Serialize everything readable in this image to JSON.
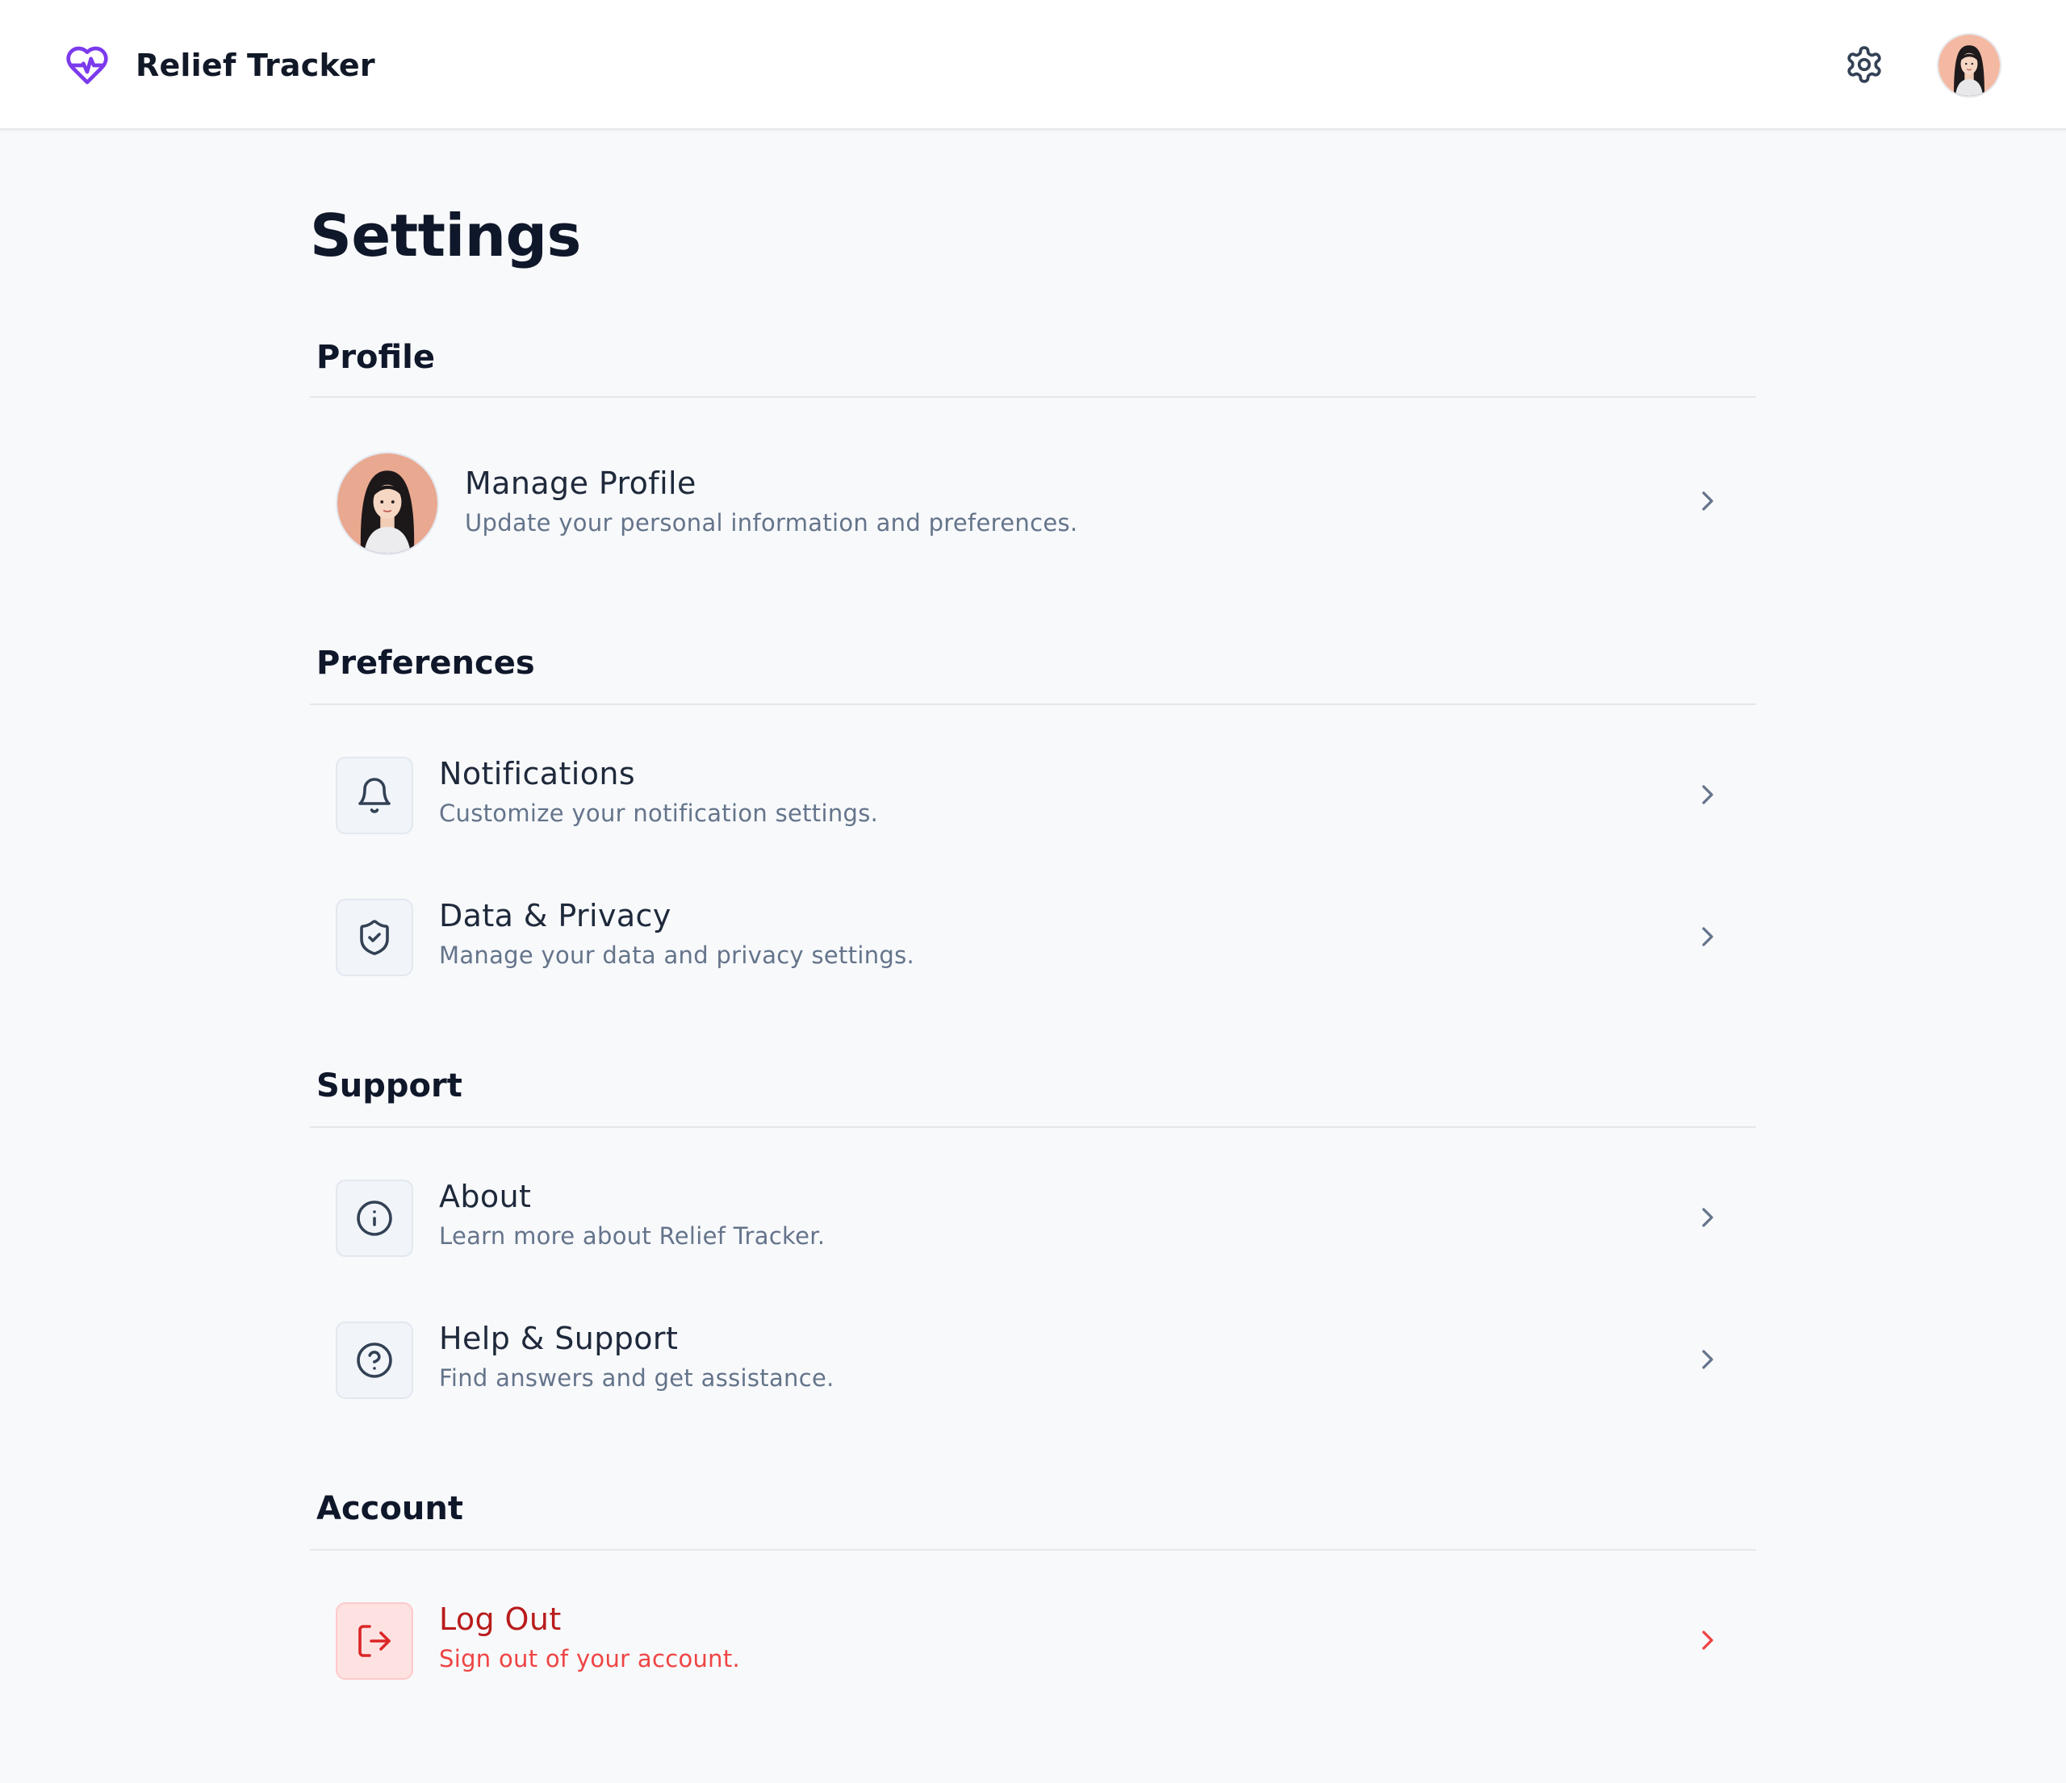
{
  "app": {
    "title": "Relief Tracker",
    "accent_color": "#7c3aed",
    "logo_icon": "heart-pulse-icon"
  },
  "header": {
    "settings_icon": "gear-icon",
    "avatar_icon": "user-avatar"
  },
  "page": {
    "title": "Settings"
  },
  "sections": {
    "profile": {
      "heading": "Profile",
      "items": [
        {
          "title": "Manage Profile",
          "subtitle": "Update your personal information and preferences.",
          "icon": "user-avatar"
        }
      ]
    },
    "preferences": {
      "heading": "Preferences",
      "items": [
        {
          "title": "Notifications",
          "subtitle": "Customize your notification settings.",
          "icon": "bell-icon"
        },
        {
          "title": "Data & Privacy",
          "subtitle": "Manage your data and privacy settings.",
          "icon": "shield-check-icon"
        }
      ]
    },
    "support": {
      "heading": "Support",
      "items": [
        {
          "title": "About",
          "subtitle": "Learn more about Relief Tracker.",
          "icon": "info-icon"
        },
        {
          "title": "Help & Support",
          "subtitle": "Find answers and get assistance.",
          "icon": "help-circle-icon"
        }
      ]
    },
    "account": {
      "heading": "Account",
      "items": [
        {
          "title": "Log Out",
          "subtitle": "Sign out of your account.",
          "icon": "logout-icon",
          "danger_color": "#dc2626"
        }
      ]
    }
  }
}
